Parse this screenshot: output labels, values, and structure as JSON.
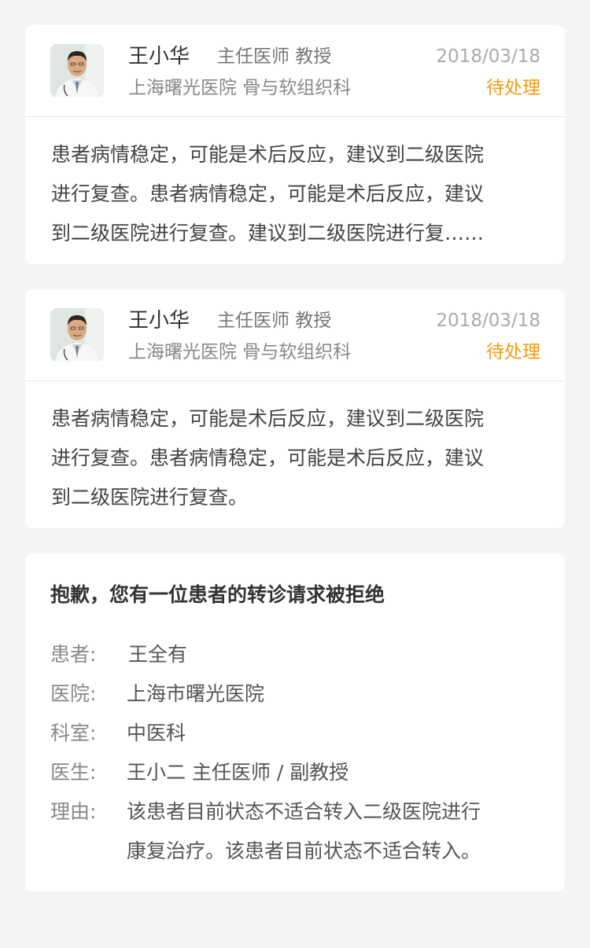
{
  "doctor_cards": [
    {
      "avatar_alt": "doctor-avatar",
      "name": "王小华",
      "title": "主任医师 教授",
      "date": "2018/03/18",
      "hospital": "上海曙光医院 骨与软组织科",
      "status": "待处理",
      "body_lines": [
        "患者病情稳定，可能是术后反应，建议到二级医院",
        "进行复查。患者病情稳定，可能是术后反应，建议",
        "到二级医院进行复查。建议到二级医院进行复……"
      ]
    },
    {
      "avatar_alt": "doctor-avatar",
      "name": "王小华",
      "title": "主任医师 教授",
      "date": "2018/03/18",
      "hospital": "上海曙光医院 骨与软组织科",
      "status": "待处理",
      "body_lines": [
        "患者病情稳定，可能是术后反应，建议到二级医院",
        "进行复查。患者病情稳定，可能是术后反应，建议",
        "到二级医院进行复查。"
      ]
    }
  ],
  "rejection": {
    "title": "抱歉，您有一位患者的转诊请求被拒绝",
    "patient_label": "患者:",
    "patient": "王全有",
    "hospital_label": "医院:",
    "hospital": "上海市曙光医院",
    "department_label": "科室:",
    "department": "中医科",
    "doctor_label": "医生:",
    "doctor": "王小二 主任医师 / 副教授",
    "reason_label": "理由:",
    "reason_lines": [
      "该患者目前状态不适合转入二级医院进行",
      "康复治疗。该患者目前状态不适合转入。"
    ]
  },
  "colors": {
    "background": "#f4f4f4",
    "card": "#ffffff",
    "status_pending": "#f39c12",
    "divider": "#e6e6e6"
  }
}
